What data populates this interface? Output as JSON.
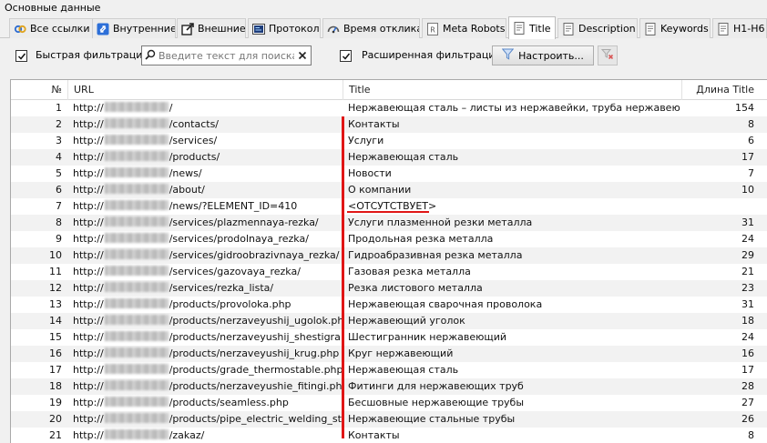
{
  "group_label": "Основные данные",
  "tabs": [
    {
      "label": "Все ссылки",
      "icon": "all-links-icon",
      "active": false
    },
    {
      "label": "Внутренние",
      "icon": "internal-links-icon",
      "active": false
    },
    {
      "label": "Внешние",
      "icon": "external-links-icon",
      "active": false
    },
    {
      "label": "Протокол",
      "icon": "protocol-icon",
      "active": false
    },
    {
      "label": "Время отклика",
      "icon": "gauge-icon",
      "active": false
    },
    {
      "label": "Meta Robots",
      "icon": "robots-icon",
      "active": false
    },
    {
      "label": "Title",
      "icon": "document-icon",
      "active": true
    },
    {
      "label": "Description",
      "icon": "document-icon",
      "active": false
    },
    {
      "label": "Keywords",
      "icon": "document-icon",
      "active": false
    },
    {
      "label": "H1-H6",
      "icon": "document-icon",
      "active": false
    }
  ],
  "filters": {
    "quick_label": "Быстрая фильтрация:",
    "quick_checked": true,
    "search_placeholder": "Введите текст для поиска...",
    "advanced_label": "Расширенная фильтрация:",
    "advanced_checked": true,
    "configure_label": "Настроить..."
  },
  "grid": {
    "headers": {
      "num": "№",
      "url": "URL",
      "title": "Title",
      "length": "Длина Title"
    },
    "rows": [
      {
        "num": "1",
        "url_prefix": "http://",
        "url_path": "/",
        "title": "Нержавеющая сталь – листы из нержавейки, труба нержавеющая ...",
        "length": "154"
      },
      {
        "num": "2",
        "url_prefix": "http://",
        "url_path": "/contacts/",
        "title": "Контакты",
        "length": "8"
      },
      {
        "num": "3",
        "url_prefix": "http://",
        "url_path": "/services/",
        "title": "Услуги",
        "length": "6"
      },
      {
        "num": "4",
        "url_prefix": "http://",
        "url_path": "/products/",
        "title": "Нержавеющая сталь",
        "length": "17"
      },
      {
        "num": "5",
        "url_prefix": "http://",
        "url_path": "/news/",
        "title": "Новости",
        "length": "7"
      },
      {
        "num": "6",
        "url_prefix": "http://",
        "url_path": "/about/",
        "title": "О компании",
        "length": "10"
      },
      {
        "num": "7",
        "url_prefix": "http://",
        "url_path": "/news/?ELEMENT_ID=410",
        "title": "<ОТСУТСТВУЕТ>",
        "length": ""
      },
      {
        "num": "8",
        "url_prefix": "http://",
        "url_path": "/services/plazmennaya-rezka/",
        "title": "Услуги плазменной резки металла",
        "length": "31"
      },
      {
        "num": "9",
        "url_prefix": "http://",
        "url_path": "/services/prodolnaya_rezka/",
        "title": "Продольная резка металла",
        "length": "24"
      },
      {
        "num": "10",
        "url_prefix": "http://",
        "url_path": "/services/gidroobrazivnaya_rezka/",
        "title": "Гидроабразивная резка металла",
        "length": "29"
      },
      {
        "num": "11",
        "url_prefix": "http://",
        "url_path": "/services/gazovaya_rezka/",
        "title": "Газовая резка металла",
        "length": "21"
      },
      {
        "num": "12",
        "url_prefix": "http://",
        "url_path": "/services/rezka_lista/",
        "title": "Резка листового металла",
        "length": "23"
      },
      {
        "num": "13",
        "url_prefix": "http://",
        "url_path": "/products/provoloka.php",
        "title": "Нержавеющая сварочная проволока",
        "length": "31"
      },
      {
        "num": "14",
        "url_prefix": "http://",
        "url_path": "/products/nerzaveyushij_ugolok.php",
        "title": "Нержавеющий уголок",
        "length": "18"
      },
      {
        "num": "15",
        "url_prefix": "http://",
        "url_path": "/products/nerzaveyushij_shestigra...",
        "title": "Шестигранник нержавеющий",
        "length": "24"
      },
      {
        "num": "16",
        "url_prefix": "http://",
        "url_path": "/products/nerzaveyushij_krug.php",
        "title": "Круг нержавеющий",
        "length": "16"
      },
      {
        "num": "17",
        "url_prefix": "http://",
        "url_path": "/products/grade_thermostable.php",
        "title": "Нержавеющая сталь",
        "length": "17"
      },
      {
        "num": "18",
        "url_prefix": "http://",
        "url_path": "/products/nerzaveyushie_fitingi.php",
        "title": "Фитинги для нержавеющих труб",
        "length": "28"
      },
      {
        "num": "19",
        "url_prefix": "http://",
        "url_path": "/products/seamless.php",
        "title": "Бесшовные нержавеющие трубы",
        "length": "27"
      },
      {
        "num": "20",
        "url_prefix": "http://",
        "url_path": "/products/pipe_electric_welding_st...",
        "title": "Нержавеющие стальные трубы",
        "length": "26"
      },
      {
        "num": "21",
        "url_prefix": "http://",
        "url_path": "/zakaz/",
        "title": "Контакты",
        "length": "8"
      }
    ]
  },
  "colors": {
    "annotation_red": "#e01616",
    "row_alt": "#f2f2f2",
    "filter_icon": "#5a88c8"
  }
}
